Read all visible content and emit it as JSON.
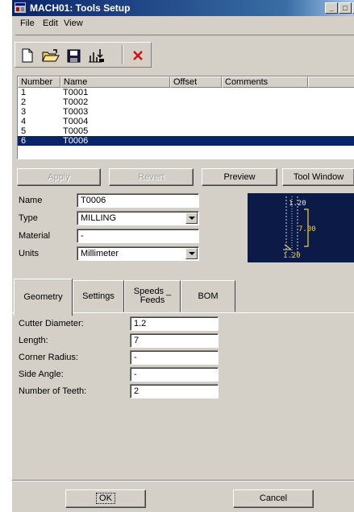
{
  "window": {
    "title": "MACH01: Tools Setup",
    "min_label": "_",
    "max_label": "□",
    "close_label": "×"
  },
  "menu": {
    "file": "File",
    "edit": "Edit",
    "view": "View"
  },
  "toolbar": {
    "icons": [
      "new-file-icon",
      "open-folder-icon",
      "save-icon",
      "import-icon",
      "delete-icon"
    ]
  },
  "list": {
    "columns": [
      "Number",
      "Name",
      "Offset",
      "Comments"
    ],
    "rows": [
      {
        "number": "1",
        "name": "T0001"
      },
      {
        "number": "2",
        "name": "T0002"
      },
      {
        "number": "3",
        "name": "T0003"
      },
      {
        "number": "4",
        "name": "T0004"
      },
      {
        "number": "5",
        "name": "T0005"
      },
      {
        "number": "6",
        "name": "T0006",
        "selected": true
      }
    ]
  },
  "actions": {
    "apply": "Apply",
    "revert": "Revert",
    "preview": "Preview",
    "tool_window": "Tool Window"
  },
  "properties": {
    "name_label": "Name",
    "name_value": "T0006",
    "type_label": "Type",
    "type_value": "MILLING",
    "material_label": "Material",
    "material_value": "-",
    "units_label": "Units",
    "units_value": "Millimeter"
  },
  "tool_preview": {
    "diameter": "1.20",
    "length": "7.00",
    "radius": "1.20",
    "background": "#0b1a46",
    "accent": "#f7d23a"
  },
  "tabs": {
    "geometry": "Geometry",
    "settings": "Settings",
    "speeds_line1": "Speeds _",
    "speeds_line2": "Feeds",
    "bom": "BOM",
    "active": "Geometry"
  },
  "geometry": {
    "cutter_diameter_label": "Cutter Diameter:",
    "cutter_diameter": "1.2",
    "length_label": "Length:",
    "length": "7",
    "corner_radius_label": "Corner Radius:",
    "corner_radius": "-",
    "side_angle_label": "Side Angle:",
    "side_angle": "-",
    "teeth_label": "Number of Teeth:",
    "teeth": "2"
  },
  "dialog": {
    "ok": "OK",
    "cancel": "Cancel"
  }
}
